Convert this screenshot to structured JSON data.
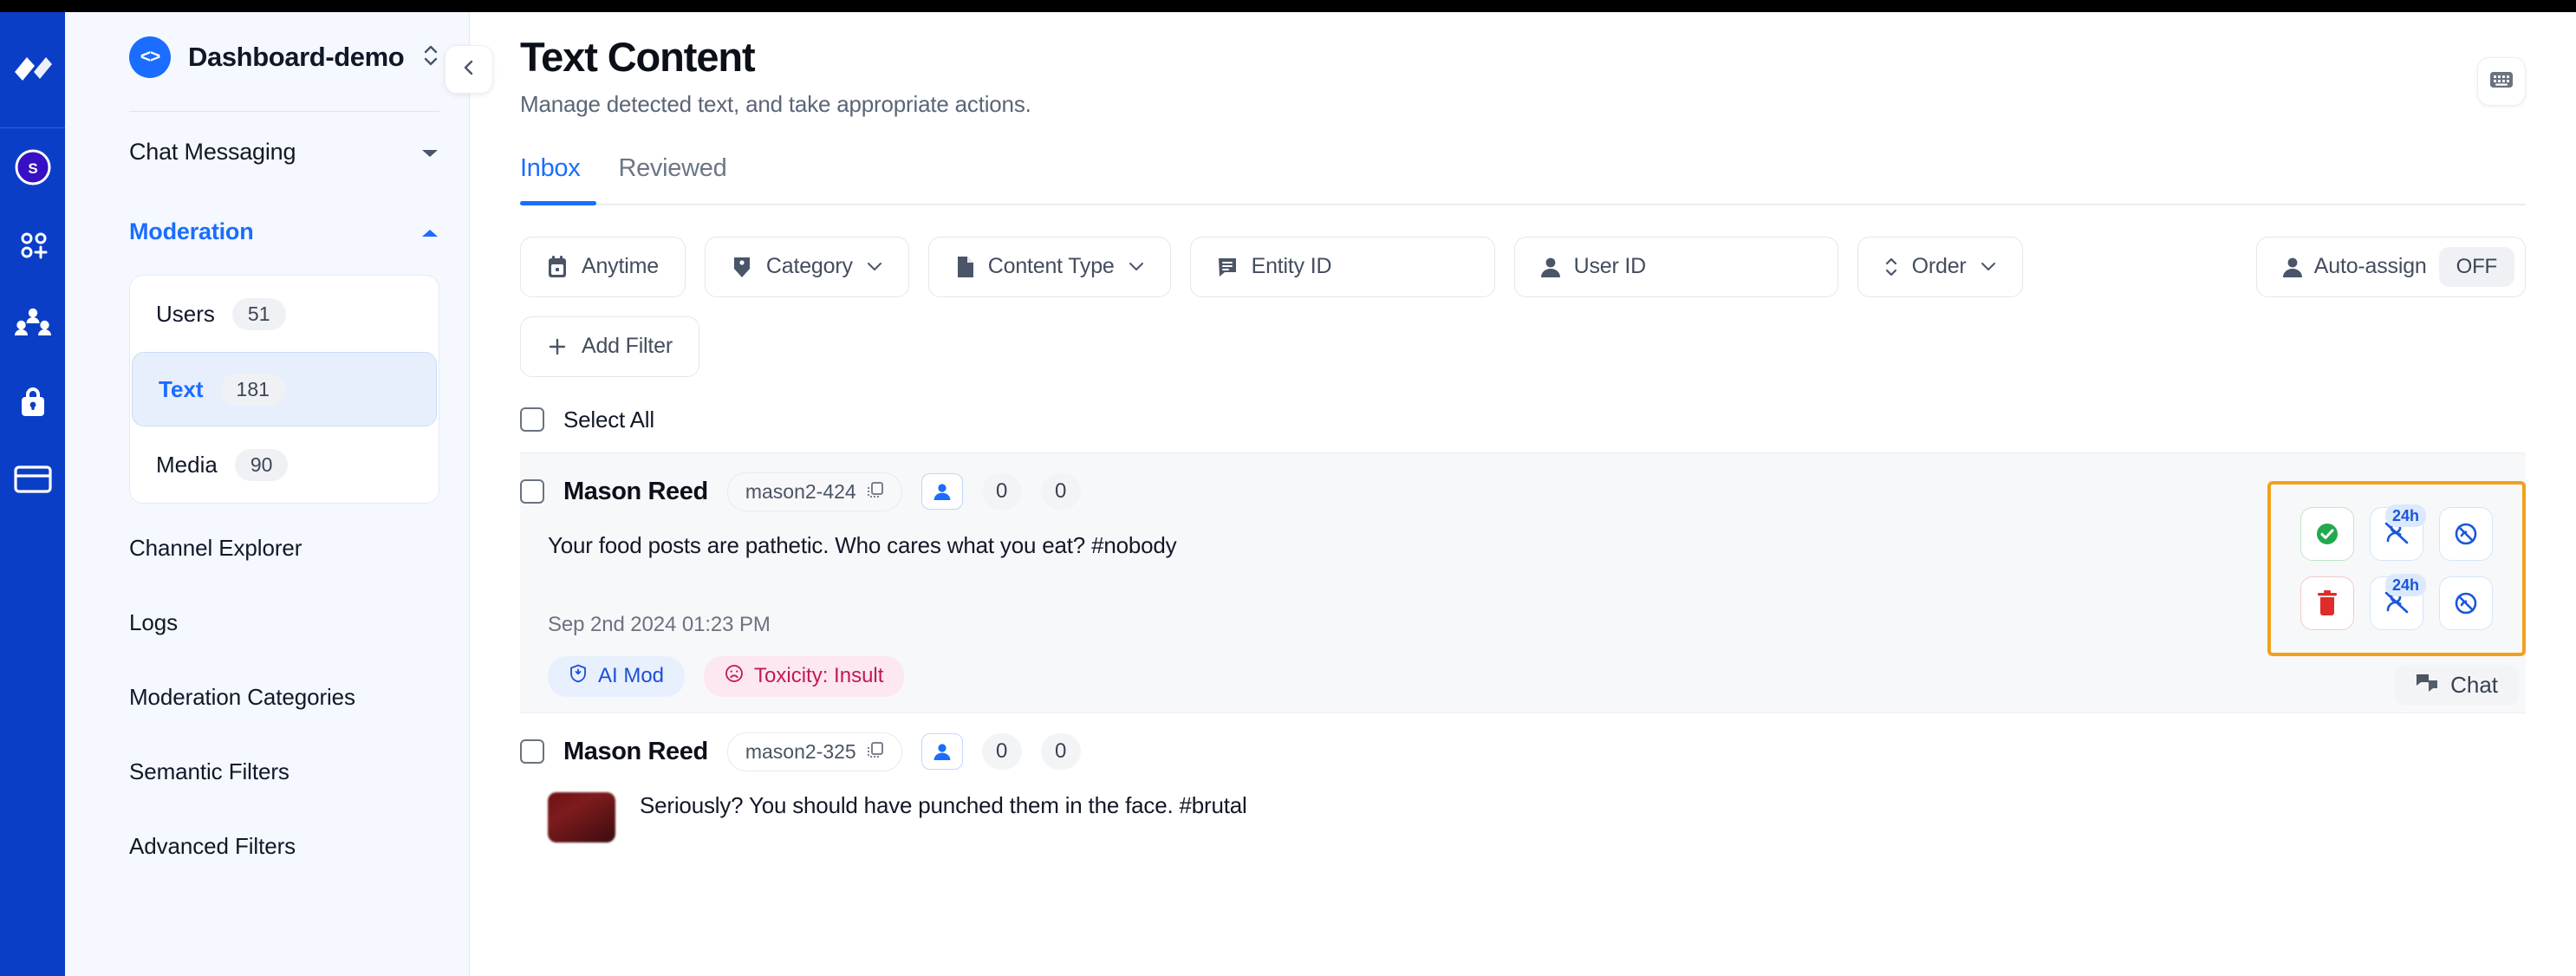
{
  "rail": {
    "logo_name": "stream-logo",
    "items": [
      {
        "name": "user-avatar",
        "label": "S"
      },
      {
        "name": "apps-add-icon",
        "label": ""
      },
      {
        "name": "people-group-icon",
        "label": ""
      },
      {
        "name": "lock-icon",
        "label": ""
      },
      {
        "name": "credit-card-icon",
        "label": ""
      }
    ]
  },
  "sidebar": {
    "project": {
      "initials": "<>",
      "name": "Dashboard-demo"
    },
    "collapse_tooltip": "Collapse sidebar",
    "groups": [
      {
        "label": "Chat Messaging",
        "expanded": false,
        "active": false,
        "items": []
      },
      {
        "label": "Moderation",
        "expanded": true,
        "active": true,
        "card_items": [
          {
            "label": "Users",
            "count": "51",
            "selected": false
          },
          {
            "label": "Text",
            "count": "181",
            "selected": true
          },
          {
            "label": "Media",
            "count": "90",
            "selected": false
          }
        ],
        "leaf_items": [
          {
            "label": "Channel Explorer"
          },
          {
            "label": "Logs"
          },
          {
            "label": "Moderation Categories"
          },
          {
            "label": "Semantic Filters"
          },
          {
            "label": "Advanced Filters"
          }
        ]
      }
    ]
  },
  "header": {
    "title": "Text Content",
    "subtitle": "Manage detected text, and take appropriate actions.",
    "keyboard_button": "keyboard-icon"
  },
  "tabs": [
    {
      "label": "Inbox",
      "active": true
    },
    {
      "label": "Reviewed",
      "active": false
    }
  ],
  "filters": {
    "chips": [
      {
        "label": "Anytime",
        "icon": "calendar-icon",
        "caret": false
      },
      {
        "label": "Category",
        "icon": "tag-icon",
        "caret": true
      },
      {
        "label": "Content Type",
        "icon": "document-icon",
        "caret": true
      },
      {
        "label": "Entity ID",
        "icon": "entity-icon",
        "caret": false
      },
      {
        "label": "User ID",
        "icon": "user-icon",
        "caret": false
      },
      {
        "label": "Order",
        "icon": "sort-icon",
        "caret": true
      }
    ],
    "auto_assign": {
      "label": "Auto-assign",
      "state": "OFF",
      "icon": "user-icon"
    },
    "add_filter": {
      "label": "Add Filter",
      "icon": "plus-icon"
    }
  },
  "select_all": {
    "label": "Select All",
    "checked": false
  },
  "items": [
    {
      "author": "Mason Reed",
      "user_id": "mason2-424",
      "copy_icon": "copy-icon",
      "flag_count_1": "0",
      "flag_count_2": "0",
      "message": "Your food posts are pathetic. Who cares what you eat? #nobody",
      "timestamp": "Sep 2nd 2024 01:23 PM",
      "has_thumbnail": false,
      "tags": [
        {
          "label": "AI Mod",
          "kind": "ai",
          "icon": "shield-check-icon"
        },
        {
          "label": "Toxicity: Insult",
          "kind": "tox",
          "icon": "frown-icon"
        }
      ],
      "highlighted": true,
      "chat_label": "Chat",
      "actions": [
        {
          "name": "approve-button",
          "icon": "check-circle-icon",
          "kind": "green",
          "badge": ""
        },
        {
          "name": "ban-24h-button",
          "icon": "ban-user-icon",
          "kind": "blue",
          "badge": "24h"
        },
        {
          "name": "shadow-ban-button",
          "icon": "eye-off-icon",
          "kind": "blue",
          "badge": ""
        },
        {
          "name": "delete-button",
          "icon": "trash-icon",
          "kind": "red",
          "badge": ""
        },
        {
          "name": "mute-24h-button",
          "icon": "ban-user-icon",
          "kind": "blue",
          "badge": "24h"
        },
        {
          "name": "hide-button",
          "icon": "eye-off-icon",
          "kind": "blue",
          "badge": ""
        }
      ]
    },
    {
      "author": "Mason Reed",
      "user_id": "mason2-325",
      "copy_icon": "copy-icon",
      "flag_count_1": "0",
      "flag_count_2": "0",
      "message": "Seriously? You should have punched them in the face. #brutal",
      "timestamp": "",
      "has_thumbnail": true,
      "tags": [],
      "highlighted": false,
      "chat_label": "",
      "actions": []
    }
  ],
  "colors": {
    "brand_blue": "#1A6DFF",
    "rail_blue": "#0B3EC7",
    "highlight_orange": "#F2A01C",
    "approve_green": "#22A94E",
    "delete_red": "#E02B2B",
    "tox_pink": "#C2185B"
  }
}
